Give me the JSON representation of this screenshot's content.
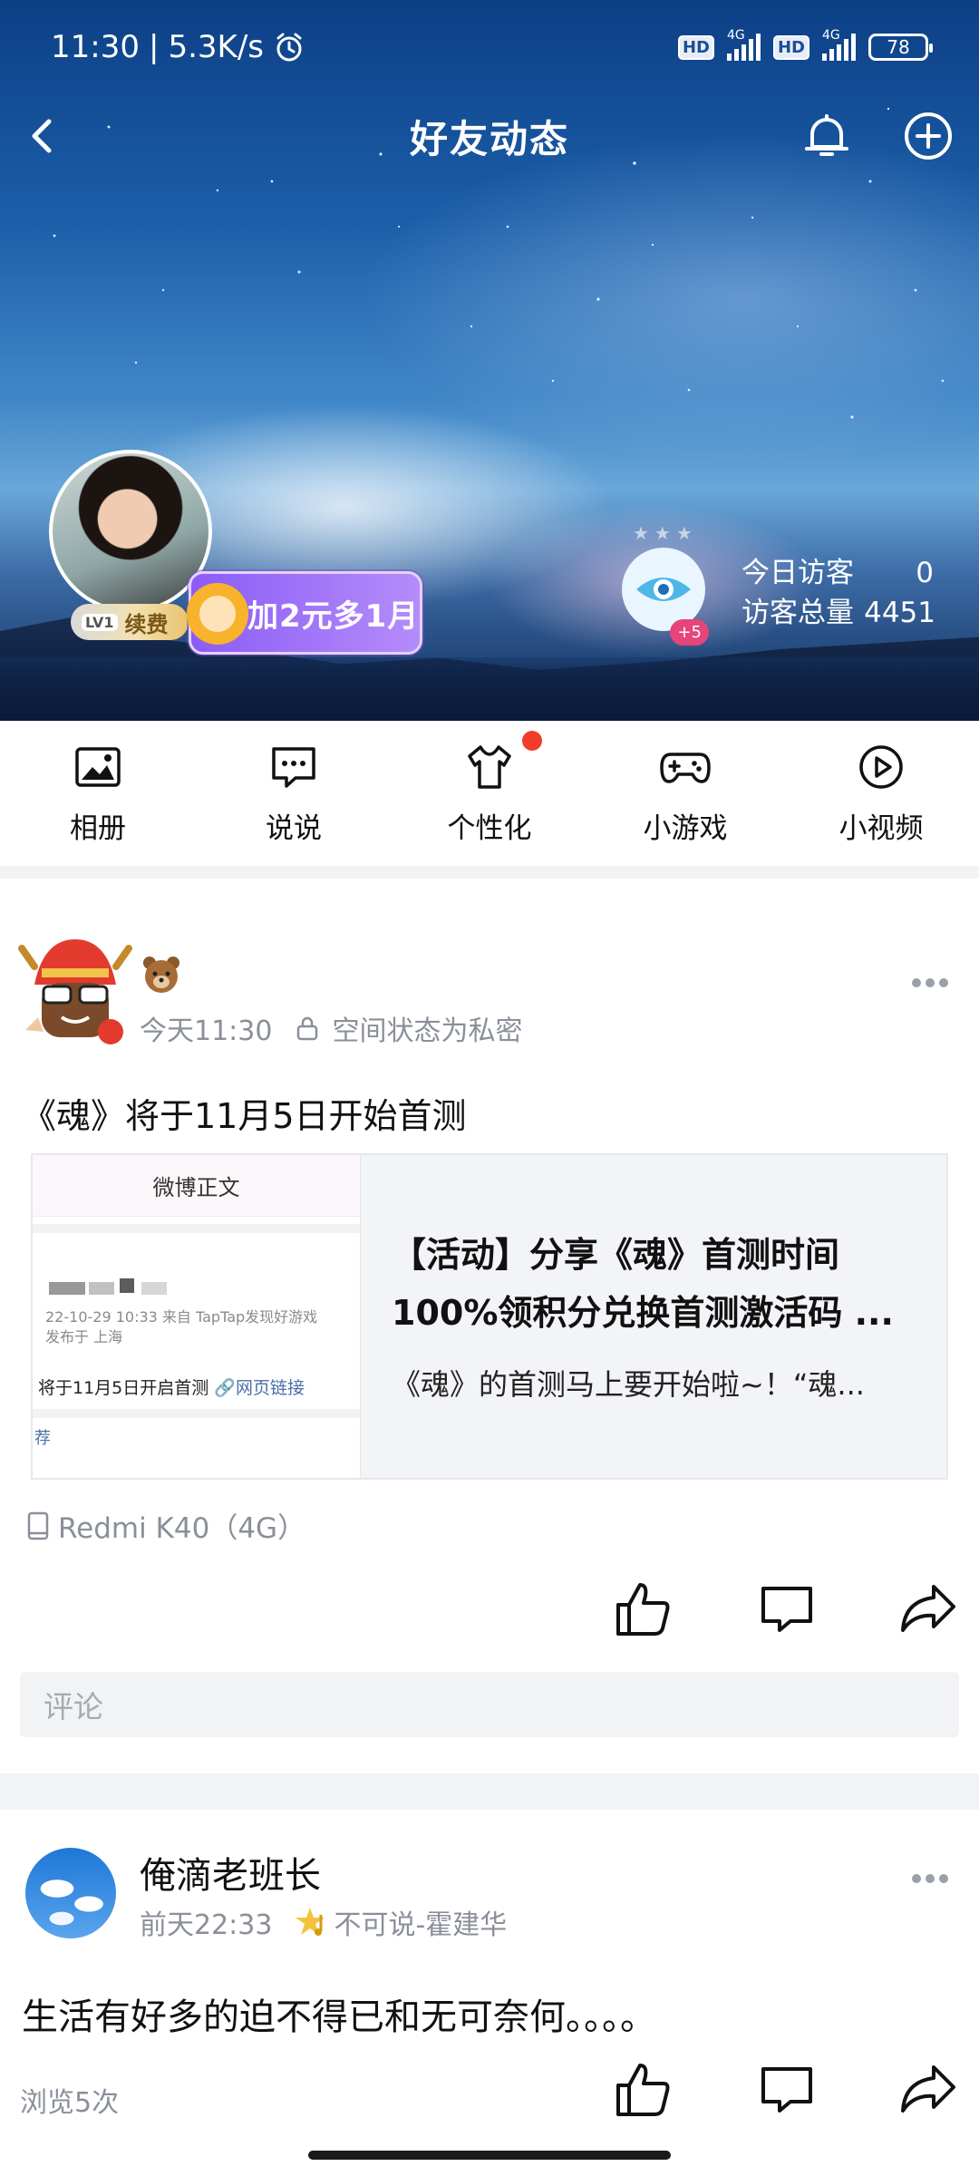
{
  "status_bar": {
    "time": "11:30",
    "speed": "5.3K/s",
    "battery": "78",
    "hd1": "HD",
    "net1": "4G",
    "hd2": "HD",
    "net2": "4G"
  },
  "header": {
    "title": "好友动态"
  },
  "profile": {
    "level": "LV1",
    "renew_label": "续费",
    "promo_text": "加2元多1月"
  },
  "visitors": {
    "today_label": "今日访客",
    "today_count": "0",
    "total_label": "访客总量",
    "total_count": "4451",
    "badge": "+5"
  },
  "nav": {
    "items": [
      {
        "label": "相册"
      },
      {
        "label": "说说"
      },
      {
        "label": "个性化"
      },
      {
        "label": "小游戏"
      },
      {
        "label": "小视频"
      }
    ]
  },
  "post1": {
    "time": "今天11:30",
    "privacy": "空间状态为私密",
    "text": "《魂》将于11月5日开始首测",
    "card": {
      "thumb_header": "微博正文",
      "thumb_meta": "22-10-29 10:33  来自 TapTap发现好游戏",
      "thumb_location": "发布于 上海",
      "thumb_line": "将于11月5日开启首测",
      "thumb_link": "网页链接",
      "thumb_rec": "荐",
      "title_line1": "【活动】分享《魂》首测时间",
      "title_line2": "100%领积分兑换首测激活码 ...",
      "desc": "《魂》的首测马上要开始啦~！“魂..."
    },
    "device": "Redmi K40（4G）",
    "comment_placeholder": "评论"
  },
  "post2": {
    "name": "俺滴老班长",
    "time": "前天22:33",
    "music": "不可说-霍建华",
    "text": "生活有好多的迫不得已和无可奈何。。。。",
    "views": "浏览5次"
  }
}
